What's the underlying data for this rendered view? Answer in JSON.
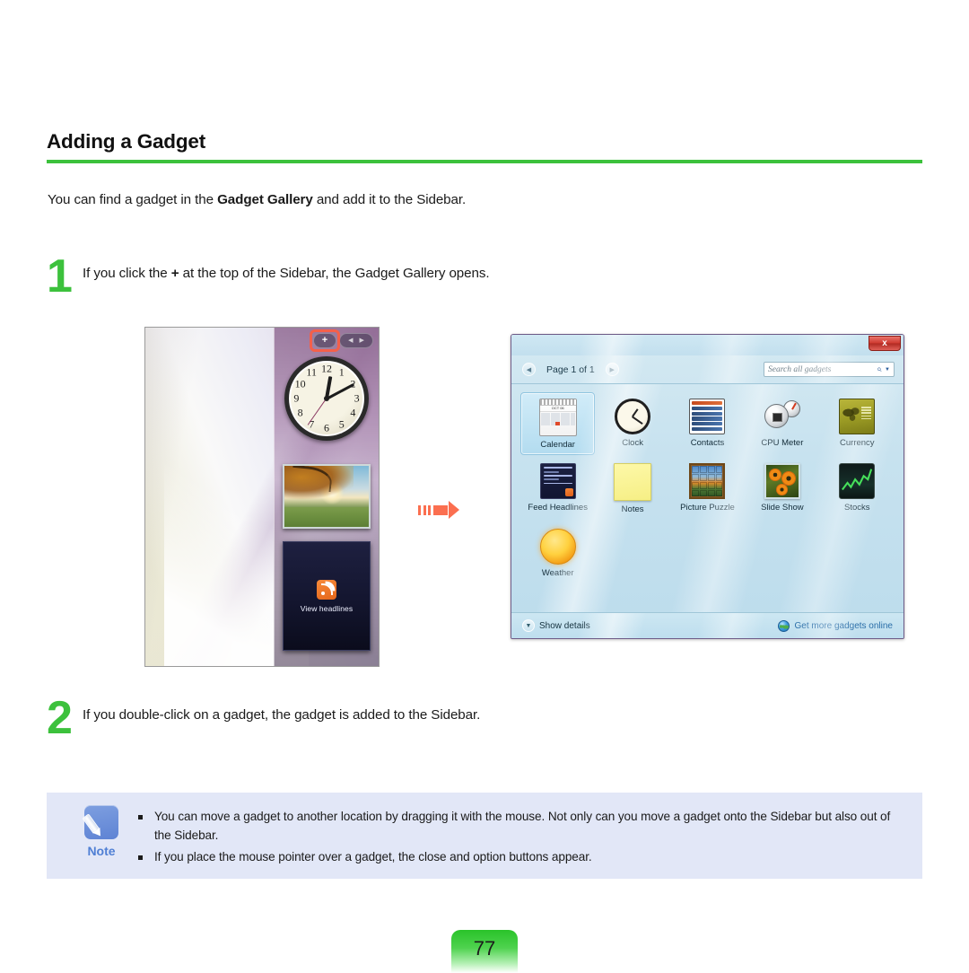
{
  "document": {
    "heading": "Adding a Gadget",
    "intro_before": "You can find a gadget in the ",
    "intro_bold": "Gadget Gallery",
    "intro_after": " and add it to the Sidebar.",
    "page_number": "77",
    "accent_green": "#3cc13c",
    "arrow_color": "#fb6f50"
  },
  "steps": [
    {
      "number": "1",
      "text_before": "If you click the ",
      "text_bold": "+",
      "text_after": " at the top of the Sidebar, the Gadget Gallery opens."
    },
    {
      "number": "2",
      "text_before": "If you double-click on a gadget, the gadget is added to the Sidebar.",
      "text_bold": "",
      "text_after": ""
    }
  ],
  "sidebar_figure": {
    "add_button_label": "+",
    "prev_arrow": "◀",
    "next_arrow": "▶",
    "clock_numbers": [
      "12",
      "1",
      "2",
      "3",
      "4",
      "5",
      "6",
      "7",
      "8",
      "9",
      "10",
      "11"
    ],
    "feed_gadget_label": "View headlines",
    "highlight_color": "#f4604a"
  },
  "gallery": {
    "close_label": "x",
    "prev_page_arrow": "◀",
    "next_page_arrow": "▶",
    "page_label": "Page 1 of 1",
    "search_placeholder": "Search all gadgets",
    "search_icon": "⌕",
    "search_caret": "▼",
    "gadgets": [
      {
        "name": "Calendar",
        "selected": true
      },
      {
        "name": "Clock",
        "selected": false
      },
      {
        "name": "Contacts",
        "selected": false
      },
      {
        "name": "CPU Meter",
        "selected": false
      },
      {
        "name": "Currency",
        "selected": false
      },
      {
        "name": "Feed Headlines",
        "selected": false
      },
      {
        "name": "Notes",
        "selected": false
      },
      {
        "name": "Picture Puzzle",
        "selected": false
      },
      {
        "name": "Slide Show",
        "selected": false
      },
      {
        "name": "Stocks",
        "selected": false
      },
      {
        "name": "Weather",
        "selected": false
      }
    ],
    "calendar_icon_header": "OCT 06",
    "footer": {
      "show_details_label": "Show details",
      "show_details_chevron": "▼",
      "get_more_label": "Get more gadgets online"
    }
  },
  "note": {
    "label": "Note",
    "items": [
      "You can move a gadget to another location by dragging it with the mouse. Not only can you move a gadget onto the Sidebar but also out of the Sidebar.",
      "If you place the mouse pointer over a gadget, the close and option buttons appear."
    ]
  }
}
